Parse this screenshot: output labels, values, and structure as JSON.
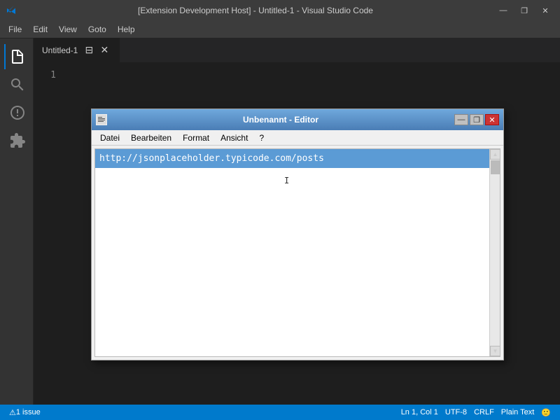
{
  "titlebar": {
    "title": "[Extension Development Host] - Untitled-1 - Visual Studio Code",
    "icon": "VS",
    "minimize": "—",
    "maximize": "❐",
    "close": "✕"
  },
  "menubar": {
    "items": [
      "File",
      "Edit",
      "View",
      "Goto",
      "Help"
    ]
  },
  "activity_bar": {
    "icons": [
      {
        "name": "files-icon",
        "symbol": "⧉",
        "active": true
      },
      {
        "name": "search-icon",
        "symbol": "🔍"
      },
      {
        "name": "source-control-icon",
        "symbol": "⑂"
      },
      {
        "name": "extensions-icon",
        "symbol": "⊞"
      }
    ]
  },
  "tab": {
    "label": "Untitled-1",
    "split_icon": "⊟",
    "close_icon": "✕"
  },
  "code": {
    "line1": "1",
    "content": ""
  },
  "dialog": {
    "title": "Unbenannt - Editor",
    "icon": "📄",
    "minimize": "—",
    "maximize": "❐",
    "close": "✕",
    "menu": [
      "Datei",
      "Bearbeiten",
      "Format",
      "Ansicht",
      "?"
    ],
    "url": "http://jsonplaceholder.typicode.com/posts",
    "cursor": "I"
  },
  "statusbar": {
    "left": {
      "issue_icon": "⚠",
      "issue_label": "1 issue"
    },
    "right": {
      "position": "Ln 1, Col 1",
      "encoding": "UTF-8",
      "line_ending": "CRLF",
      "language": "Plain Text",
      "smiley": "🙂"
    }
  }
}
